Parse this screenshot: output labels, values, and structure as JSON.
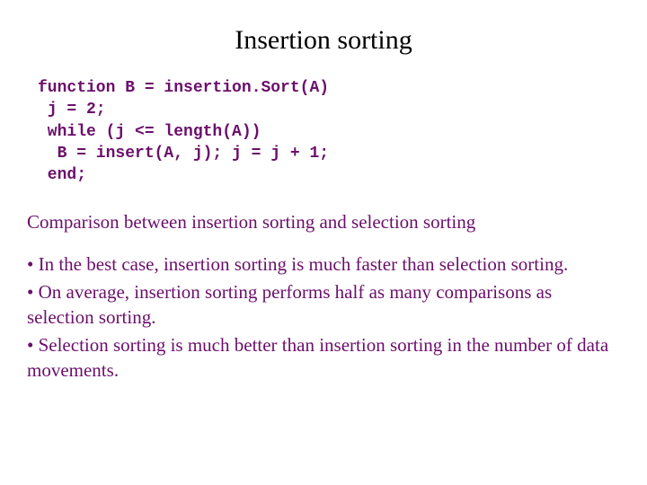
{
  "title": "Insertion sorting",
  "code": {
    "l1": "function B = insertion.Sort(A)",
    "l2": " j = 2;",
    "l3": " while (j <= length(A))",
    "l4": "  B = insert(A, j); j = j + 1;",
    "l5": " end;"
  },
  "subheading": "Comparison between insertion sorting and selection sorting",
  "bullets": {
    "b1": " •  In the best case, insertion sorting is much faster than selection sorting.",
    "b2": " • On average, insertion sorting performs half as many comparisons as selection sorting.",
    "b3": " • Selection sorting is much better than insertion sorting in the number of data movements."
  }
}
